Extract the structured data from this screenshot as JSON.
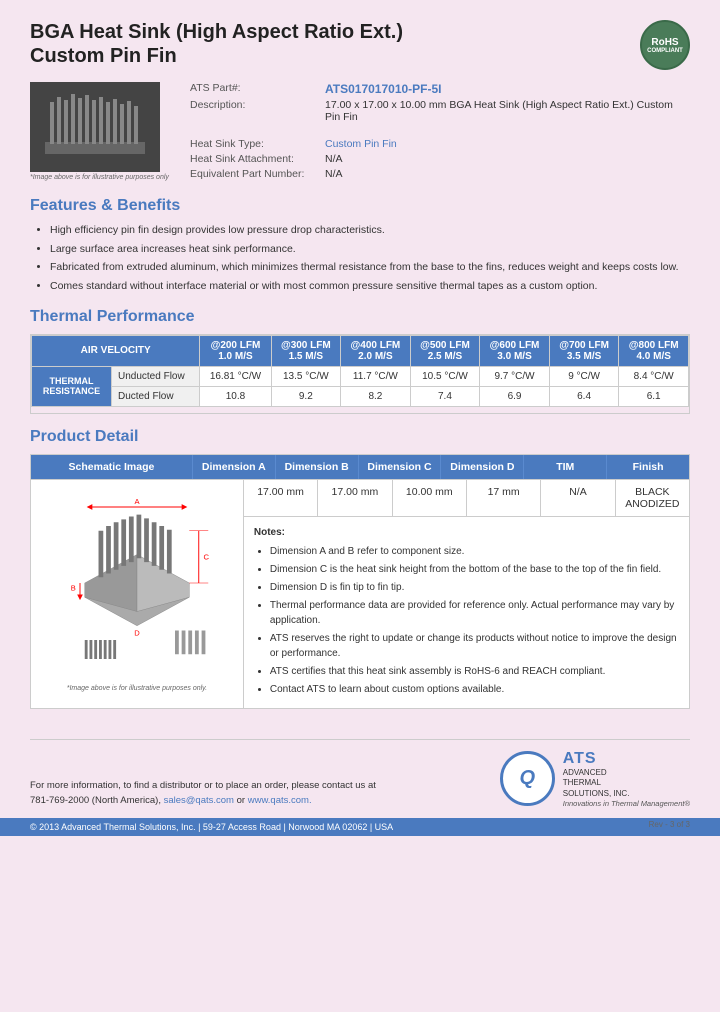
{
  "header": {
    "title_line1": "BGA Heat Sink (High Aspect Ratio Ext.)",
    "title_line2": "Custom Pin Fin",
    "rohs": "RoHS\nCOMPLIANT"
  },
  "specs": {
    "ats_part_label": "ATS Part#:",
    "ats_part_value": "ATS017017010-PF-5I",
    "description_label": "Description:",
    "description_value": "17.00 x 17.00 x 10.00 mm BGA Heat Sink (High Aspect Ratio Ext.) Custom Pin Fin",
    "heat_sink_type_label": "Heat Sink Type:",
    "heat_sink_type_value": "Custom Pin Fin",
    "attachment_label": "Heat Sink Attachment:",
    "attachment_value": "N/A",
    "equiv_part_label": "Equivalent Part Number:",
    "equiv_part_value": "N/A"
  },
  "image_caption": "*Image above is for illustrative purposes only",
  "features": {
    "section_title": "Features & Benefits",
    "items": [
      "High efficiency pin fin design provides low pressure drop characteristics.",
      "Large surface area increases heat sink performance.",
      "Fabricated from extruded aluminum, which minimizes thermal resistance from the base to the fins, reduces weight and keeps costs low.",
      "Comes standard without interface material or with most common pressure sensitive thermal tapes as a custom option."
    ]
  },
  "thermal": {
    "section_title": "Thermal Performance",
    "col_header": "AIR VELOCITY",
    "row_header": "THERMAL RESISTANCE",
    "columns": [
      "@200 LFM\n1.0 M/S",
      "@300 LFM\n1.5 M/S",
      "@400 LFM\n2.0 M/S",
      "@500 LFM\n2.5 M/S",
      "@600 LFM\n3.0 M/S",
      "@700 LFM\n3.5 M/S",
      "@800 LFM\n4.0 M/S"
    ],
    "rows": [
      {
        "label": "Unducted Flow",
        "values": [
          "16.81 °C/W",
          "13.5 °C/W",
          "11.7 °C/W",
          "10.5 °C/W",
          "9.7 °C/W",
          "9 °C/W",
          "8.4 °C/W"
        ]
      },
      {
        "label": "Ducted Flow",
        "values": [
          "10.8",
          "9.2",
          "8.2",
          "7.4",
          "6.9",
          "6.4",
          "6.1"
        ]
      }
    ]
  },
  "product_detail": {
    "section_title": "Product Detail",
    "schematic_label": "Schematic Image",
    "schematic_caption": "*Image above is for illustrative purposes only.",
    "dim_headers": [
      "Dimension A",
      "Dimension B",
      "Dimension C",
      "Dimension D",
      "TIM",
      "Finish"
    ],
    "dim_values": [
      "17.00 mm",
      "17.00 mm",
      "10.00 mm",
      "17 mm",
      "N/A",
      "BLACK ANODIZED"
    ],
    "notes_title": "Notes:",
    "notes": [
      "Dimension A and B refer to component size.",
      "Dimension C is the heat sink height from the bottom of the base to the top of the fin field.",
      "Dimension D is fin tip to fin tip.",
      "Thermal performance data are provided for reference only. Actual performance may vary by application.",
      "ATS reserves the right to update or change its products without notice to improve the design or performance.",
      "ATS certifies that this heat sink assembly is RoHS-6 and REACH compliant.",
      "Contact ATS to learn about custom options available."
    ]
  },
  "footer": {
    "contact_text": "For more information, to find a distributor or to place an order, please contact us at",
    "phone": "781-769-2000 (North America),",
    "email": "sales@qats.com",
    "or_text": "or",
    "website": "www.qats.com.",
    "copyright": "© 2013 Advanced Thermal Solutions, Inc.  |  59-27 Access Road  |  Norwood MA   02062  |  USA",
    "ats_brand": "ATS",
    "ats_full": "ADVANCED\nTHERMAL\nSOLUTIONS, INC.",
    "ats_tagline": "Innovations in Thermal Management®",
    "page_num": "Rev - 3 of 3"
  }
}
